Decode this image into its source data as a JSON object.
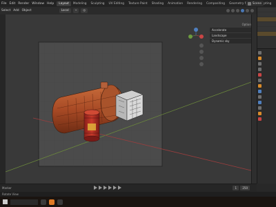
{
  "app": {
    "menu": [
      "File",
      "Edit",
      "Render",
      "Window",
      "Help"
    ],
    "workspace_tabs": [
      "Layout",
      "Modeling",
      "Sculpting",
      "UV Editing",
      "Texture Paint",
      "Shading",
      "Animation",
      "Rendering",
      "Compositing",
      "Geometry Nodes",
      "Scripting"
    ],
    "active_tab": "Layout",
    "scene_label": "Scene"
  },
  "viewport_header": {
    "menus": [
      "Select",
      "Add",
      "Object"
    ],
    "transform": "Local"
  },
  "overlay_panel": {
    "options_label": "Options",
    "rows": [
      "Accelerate",
      "Landscape",
      "Dynamic sky"
    ]
  },
  "timeline": {
    "start": "1",
    "end": "250",
    "left_label": "Marker"
  },
  "status_bar": {
    "text": "Rotate View"
  },
  "colors": {
    "background": "#3a3a3a",
    "grid": "#4a4a4a",
    "x_axis": "#9c3e3e",
    "y_axis": "#6c8a3c",
    "object_orange": "#b1542a",
    "blender_orange": "#e07a25"
  }
}
